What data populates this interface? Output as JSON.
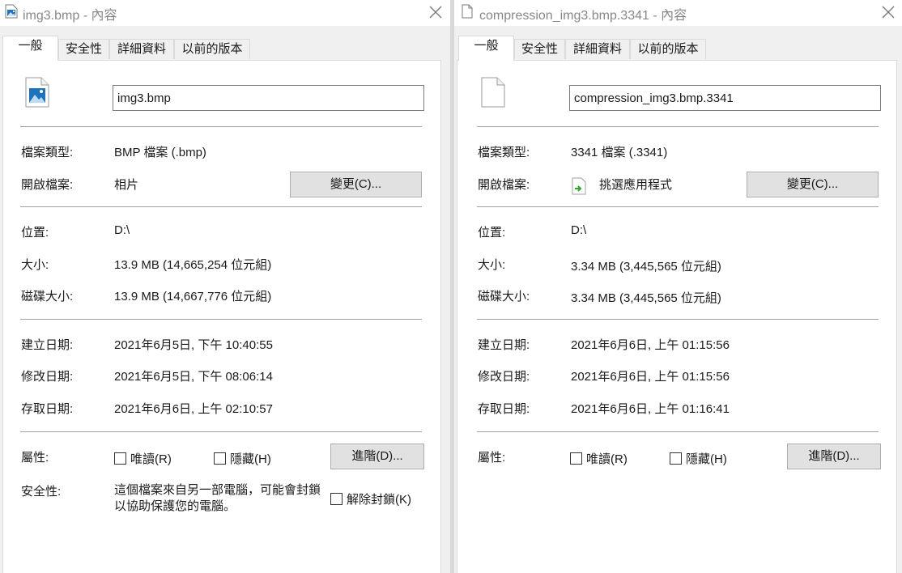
{
  "win1": {
    "title": "img3.bmp - 內容",
    "tabs": [
      "一般",
      "安全性",
      "詳細資料",
      "以前的版本"
    ],
    "file_name": "img3.bmp",
    "labels": {
      "type": "檔案類型:",
      "opens_with": "開啟檔案:",
      "location": "位置:",
      "size": "大小:",
      "size_on_disk": "磁碟大小:",
      "created": "建立日期:",
      "modified": "修改日期:",
      "accessed": "存取日期:",
      "attributes": "屬性:",
      "security": "安全性:"
    },
    "values": {
      "type": "BMP 檔案 (.bmp)",
      "opens_with": "相片",
      "location": "D:\\",
      "size": "13.9 MB (14,665,254 位元組)",
      "size_on_disk": "13.9 MB (14,667,776 位元組)",
      "created": "2021年6月5日, 下午 10:40:55",
      "modified": "2021年6月5日, 下午 08:06:14",
      "accessed": "2021年6月6日, 上午 02:10:57"
    },
    "change_button": "變更(C)...",
    "readonly_label": "唯讀(R)",
    "hidden_label": "隱藏(H)",
    "advanced_button": "進階(D)...",
    "security_text": "這個檔案來自另一部電腦，可能會封鎖以協助保護您的電腦。",
    "unblock_label": "解除封鎖(K)"
  },
  "win2": {
    "title": "compression_img3.bmp.3341 - 內容",
    "tabs": [
      "一般",
      "安全性",
      "詳細資料",
      "以前的版本"
    ],
    "file_name": "compression_img3.bmp.3341",
    "labels": {
      "type": "檔案類型:",
      "opens_with": "開啟檔案:",
      "location": "位置:",
      "size": "大小:",
      "size_on_disk": "磁碟大小:",
      "created": "建立日期:",
      "modified": "修改日期:",
      "accessed": "存取日期:",
      "attributes": "屬性:"
    },
    "values": {
      "type": "3341 檔案 (.3341)",
      "opens_with": "挑選應用程式",
      "location": "D:\\",
      "size": "3.34 MB (3,445,565 位元組)",
      "size_on_disk": "3.34 MB (3,445,565 位元組)",
      "created": "2021年6月6日, 上午 01:15:56",
      "modified": "2021年6月6日, 上午 01:15:56",
      "accessed": "2021年6月6日, 上午 01:16:41"
    },
    "change_button": "變更(C)...",
    "readonly_label": "唯讀(R)",
    "hidden_label": "隱藏(H)",
    "advanced_button": "進階(D)..."
  },
  "icons": {
    "win1_title": "image-file-icon",
    "win1_large": "image-file-icon",
    "win2_title": "blank-file-icon",
    "win2_large": "blank-file-icon",
    "pick_app": "pick-app-icon",
    "close": "close-icon"
  },
  "colors": {
    "window_bg": "#f0f0f0",
    "panel_bg": "#ffffff",
    "button_bg": "#e1e1e1",
    "separator": "#a0a0a0",
    "image_icon_blue": "#1e73be",
    "app_icon_green": "#2aa82a"
  }
}
